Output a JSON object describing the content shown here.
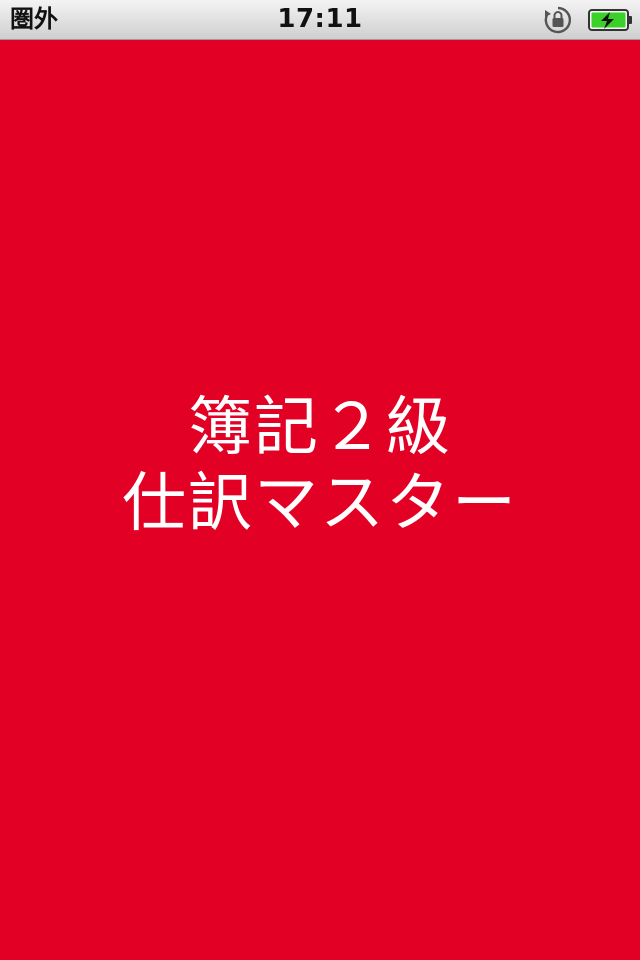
{
  "status_bar": {
    "carrier": "圏外",
    "time": "17:11",
    "icons": [
      "rotation-lock-icon",
      "battery-charging-icon"
    ],
    "battery_color": "#3bd12a"
  },
  "splash": {
    "background_color": "#e30025",
    "title_line_1": "簿記２級",
    "title_line_2": "仕訳マスター"
  }
}
